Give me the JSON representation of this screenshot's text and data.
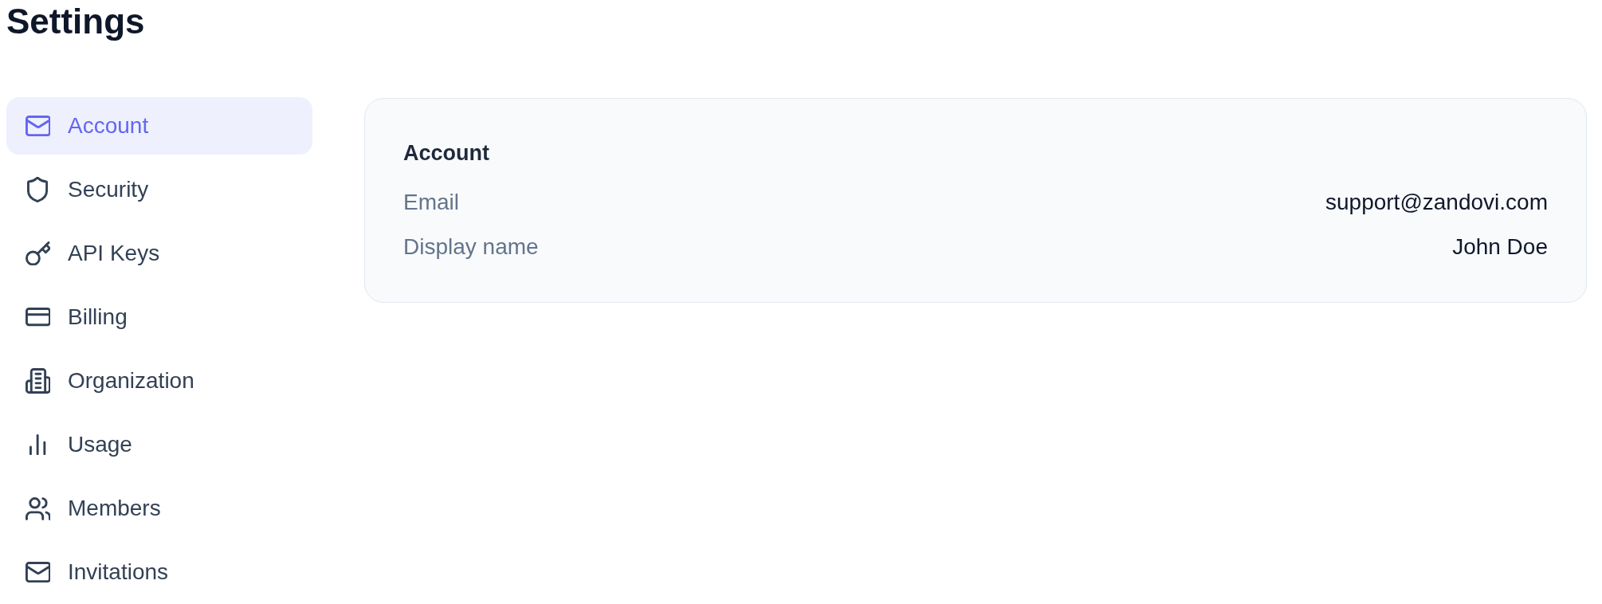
{
  "page": {
    "title": "Settings"
  },
  "sidebar": {
    "items": [
      {
        "label": "Account",
        "selected": true
      },
      {
        "label": "Security",
        "selected": false
      },
      {
        "label": "API Keys",
        "selected": false
      },
      {
        "label": "Billing",
        "selected": false
      },
      {
        "label": "Organization",
        "selected": false
      },
      {
        "label": "Usage",
        "selected": false
      },
      {
        "label": "Members",
        "selected": false
      },
      {
        "label": "Invitations",
        "selected": false
      }
    ]
  },
  "account_card": {
    "title": "Account",
    "fields": [
      {
        "label": "Email",
        "value": "support@zandovi.com"
      },
      {
        "label": "Display name",
        "value": "John Doe"
      }
    ]
  }
}
